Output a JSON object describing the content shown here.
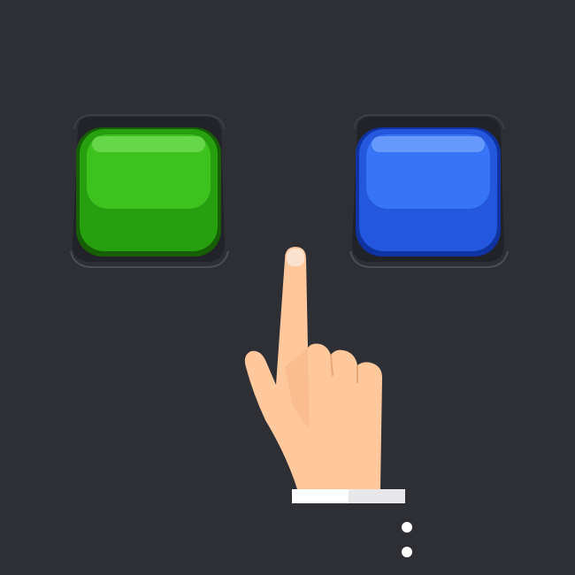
{
  "buttons": [
    {
      "name": "green-button",
      "color": "#2fae12",
      "highlight": "#49d02a",
      "dark": "#1b6f09"
    },
    {
      "name": "blue-button",
      "color": "#2a64e8",
      "highlight": "#4b86ff",
      "dark": "#1440b3"
    }
  ],
  "background_color": "#2e2f35",
  "hand": {
    "icon": "pointing-hand-icon",
    "skin": "#ffc9a0",
    "cuff": "#ffffff"
  },
  "menu": {
    "icon": "more-vertical-icon"
  }
}
